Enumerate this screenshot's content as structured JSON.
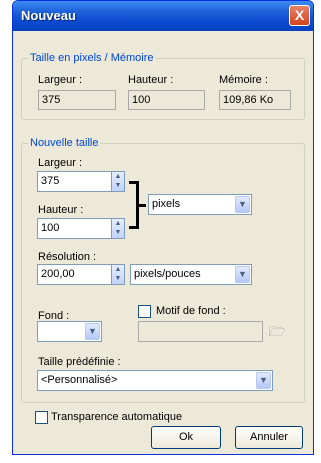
{
  "window": {
    "title": "Nouveau",
    "close_glyph": "X"
  },
  "memory_group": {
    "legend": "Taille en pixels / Mémoire",
    "width_label": "Largeur :",
    "width_value": "375",
    "height_label": "Hauteur :",
    "height_value": "100",
    "memory_label": "Mémoire :",
    "memory_value": "109,86 Ko"
  },
  "new_size_group": {
    "legend": "Nouvelle taille",
    "width_label": "Largeur :",
    "width_value": "375",
    "height_label": "Hauteur :",
    "height_value": "100",
    "unit_select": "pixels",
    "resolution_label": "Résolution :",
    "resolution_value": "200,00",
    "resolution_unit_select": "pixels/pouces",
    "background_label": "Fond :",
    "pattern_label": "Motif de fond :",
    "pattern_value": "",
    "preset_label": "Taille prédéfinie :",
    "preset_value": "<Personnalisé>"
  },
  "auto_transparency_label": "Transparence automatique",
  "buttons": {
    "ok": "Ok",
    "cancel": "Annuler"
  },
  "icons": {
    "spin": "spin-up-down-icon",
    "dropdown": "chevron-down-icon",
    "browse": "folder-open-icon",
    "close": "close-icon"
  }
}
